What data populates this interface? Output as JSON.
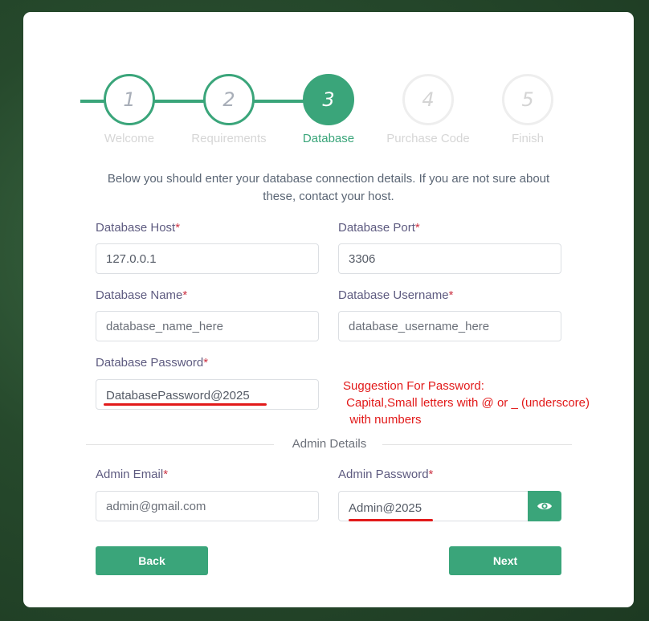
{
  "steps": [
    {
      "number": "1",
      "label": "Welcome",
      "state": "done"
    },
    {
      "number": "2",
      "label": "Requirements",
      "state": "done"
    },
    {
      "number": "3",
      "label": "Database",
      "state": "active"
    },
    {
      "number": "4",
      "label": "Purchase Code",
      "state": "todo"
    },
    {
      "number": "5",
      "label": "Finish",
      "state": "todo"
    }
  ],
  "intro": "Below you should enter your database connection details. If you are not sure about these, contact your host.",
  "form": {
    "db_host": {
      "label": "Database Host",
      "required": "*",
      "value": "127.0.0.1"
    },
    "db_port": {
      "label": "Database Port",
      "required": "*",
      "value": "3306"
    },
    "db_name": {
      "label": "Database Name",
      "required": "*",
      "placeholder": "database_name_here"
    },
    "db_username": {
      "label": "Database Username",
      "required": "*",
      "placeholder": "database_username_here"
    },
    "db_password": {
      "label": "Database Password",
      "required": "*",
      "value": "DatabasePassword@2025"
    },
    "admin_section": "Admin Details",
    "admin_email": {
      "label": "Admin Email",
      "required": "*",
      "placeholder": "admin@gmail.com"
    },
    "admin_password": {
      "label": "Admin Password",
      "required": "*",
      "value": "Admin@2025"
    }
  },
  "annotation": {
    "suggestion": "Suggestion For Password:\n Capital,Small letters with @ or _ (underscore)\n  with numbers",
    "color": "#e21a1a"
  },
  "buttons": {
    "back": "Back",
    "next": "Next"
  },
  "icons": {
    "password_toggle": "eye-icon"
  },
  "colors": {
    "accent": "#3aa57a",
    "required": "#cc3344",
    "label": "#5e5b80"
  }
}
